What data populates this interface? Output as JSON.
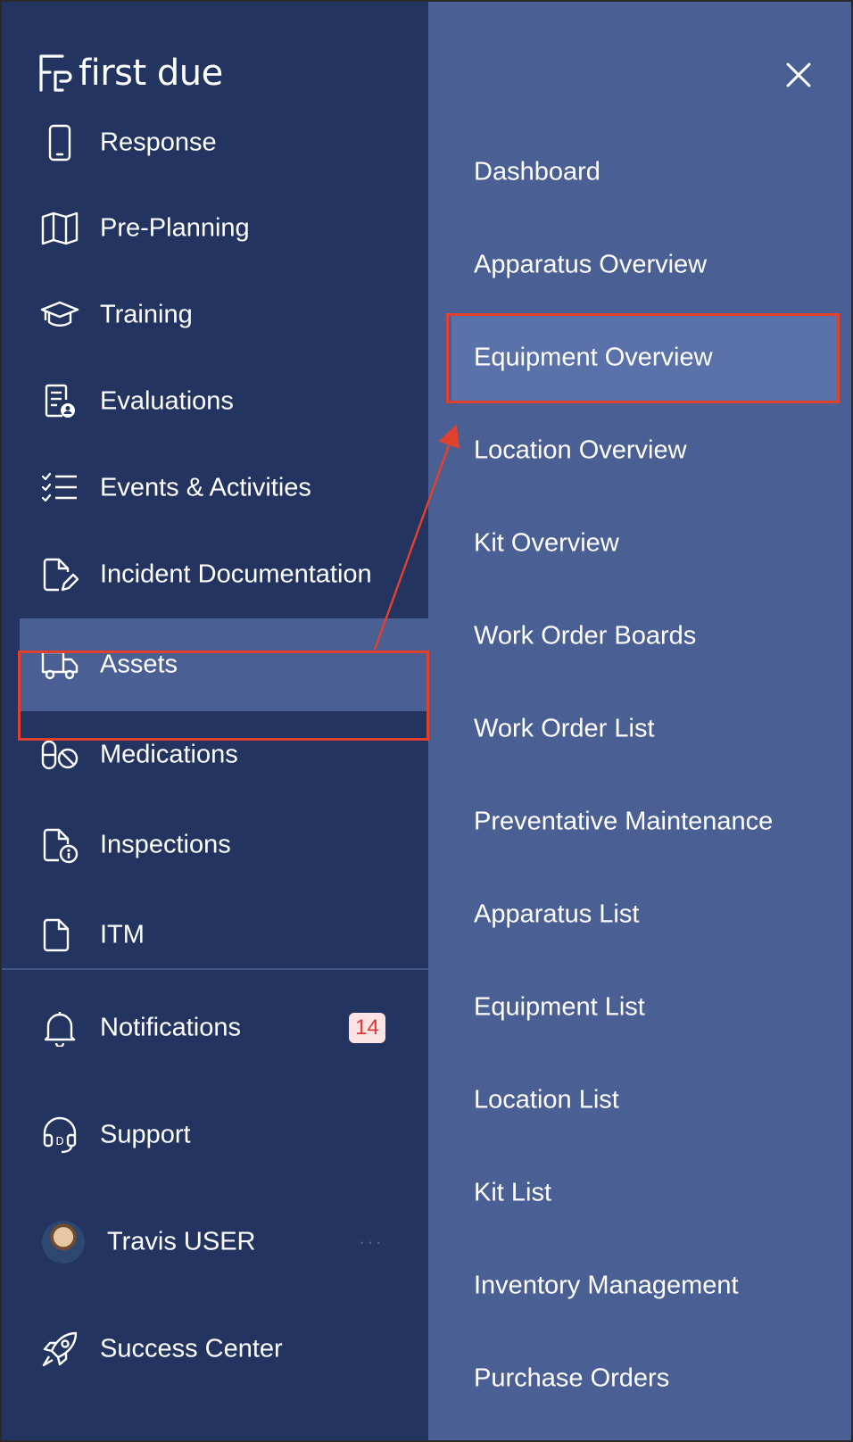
{
  "brand": {
    "name": "first due"
  },
  "sidebar": {
    "items": [
      {
        "label": "Response",
        "icon": "phone-icon"
      },
      {
        "label": "Pre-Planning",
        "icon": "map-icon"
      },
      {
        "label": "Training",
        "icon": "graduation-cap-icon"
      },
      {
        "label": "Evaluations",
        "icon": "evaluation-doc-icon"
      },
      {
        "label": "Events & Activities",
        "icon": "checklist-icon"
      },
      {
        "label": "Incident Documentation",
        "icon": "document-edit-icon"
      },
      {
        "label": "Assets",
        "icon": "truck-icon",
        "active": true
      },
      {
        "label": "Medications",
        "icon": "pills-icon"
      },
      {
        "label": "Inspections",
        "icon": "document-info-icon"
      },
      {
        "label": "ITM",
        "icon": "document-icon"
      }
    ],
    "bottom": {
      "notifications": {
        "label": "Notifications",
        "count": "14"
      },
      "support": {
        "label": "Support"
      },
      "user": {
        "name": "Travis USER",
        "more": "···"
      },
      "success": {
        "label": "Success Center"
      }
    }
  },
  "submenu": {
    "items": [
      "Dashboard",
      "Apparatus Overview",
      "Equipment Overview",
      "Location Overview",
      "Kit Overview",
      "Work Order Boards",
      "Work Order List",
      "Preventative Maintenance",
      "Apparatus List",
      "Equipment List",
      "Location List",
      "Kit List",
      "Inventory Management",
      "Purchase Orders"
    ],
    "active_index": 2
  },
  "colors": {
    "sidebar_bg": "#22345f",
    "panel_bg": "#4a5f93",
    "active_bg": "#5a72a9",
    "annotation": "#e0412f",
    "badge_bg": "#fbe3e3",
    "badge_text": "#d63a3a"
  }
}
